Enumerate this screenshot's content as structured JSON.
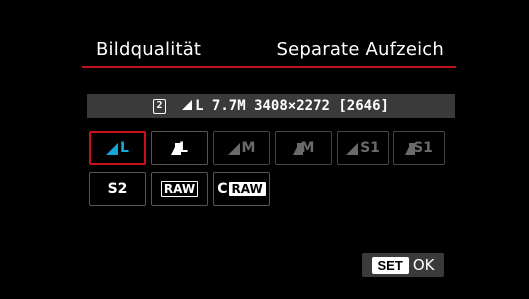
{
  "header": {
    "title": "Bildqualität",
    "subtitle": "Separate Aufzeich"
  },
  "info_bar": {
    "card_number": "2",
    "text": "L 7.7M 3408×2272 [2646]"
  },
  "quality_options": {
    "row1": [
      {
        "label": "L",
        "icon": "fine-triangle-icon",
        "state": "selected"
      },
      {
        "label": "L",
        "icon": "normal-step-icon",
        "state": "enabled"
      },
      {
        "label": "M",
        "icon": "fine-triangle-icon",
        "state": "disabled"
      },
      {
        "label": "M",
        "icon": "normal-step-icon",
        "state": "disabled"
      },
      {
        "label": "S1",
        "icon": "fine-triangle-icon",
        "state": "disabled"
      },
      {
        "label": "S1",
        "icon": "normal-step-icon",
        "state": "disabled"
      }
    ],
    "row2": [
      {
        "label": "S2",
        "state": "enabled"
      },
      {
        "label": "RAW",
        "state": "enabled"
      },
      {
        "prefix": "C",
        "label": "RAW",
        "state": "enabled"
      }
    ]
  },
  "footer": {
    "set_label": "SET",
    "ok_label": "OK"
  },
  "colors": {
    "accent_red": "#c8101a",
    "selected_blue": "#12a8d8",
    "bar_gray": "#3a3a3a"
  }
}
